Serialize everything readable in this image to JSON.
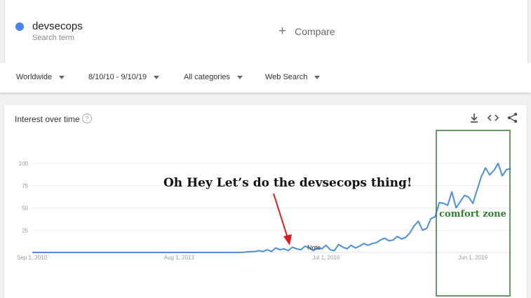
{
  "search": {
    "term": "devsecops",
    "term_sub": "Search term",
    "term_color": "#4285f4",
    "compare_label": "Compare"
  },
  "filters": [
    {
      "label": "Worldwide"
    },
    {
      "label": "8/10/10 - 9/10/19"
    },
    {
      "label": "All categories"
    },
    {
      "label": "Web Search"
    }
  ],
  "card": {
    "title": "Interest over time",
    "icons": [
      "download-icon",
      "embed-icon",
      "share-icon"
    ]
  },
  "annotations": {
    "callout": "Oh Hey Let’s do the devsecops thing!",
    "zone_label": "comfort zone",
    "note_label": "Note",
    "callout_color": "#e31a1c",
    "zone_color": "#2e7d32"
  },
  "chart_data": {
    "type": "line",
    "title": "",
    "xlabel": "",
    "ylabel": "",
    "ylim": [
      0,
      100
    ],
    "y_ticks": [
      "100",
      "75",
      "50",
      "25"
    ],
    "x_ticks": [
      {
        "label": "Sep 1, 2010",
        "month": 0
      },
      {
        "label": "Aug 1, 2013",
        "month": 35
      },
      {
        "label": "Jul 1, 2016",
        "month": 70
      },
      {
        "label": "Jun 1, 2019",
        "month": 105
      }
    ],
    "series": [
      {
        "color": "#4a90e2",
        "points": [
          [
            0,
            0
          ],
          [
            50,
            0
          ],
          [
            52,
            1
          ],
          [
            53,
            1
          ],
          [
            54,
            2
          ],
          [
            55,
            1
          ],
          [
            56,
            3
          ],
          [
            57,
            1
          ],
          [
            58,
            5
          ],
          [
            59,
            3
          ],
          [
            60,
            4
          ],
          [
            61,
            2
          ],
          [
            62,
            6
          ],
          [
            63,
            4
          ],
          [
            64,
            3
          ],
          [
            65,
            7
          ],
          [
            66,
            5
          ],
          [
            67,
            2
          ],
          [
            68,
            5
          ],
          [
            69,
            4
          ],
          [
            70,
            8
          ],
          [
            71,
            3
          ],
          [
            72,
            2
          ],
          [
            73,
            9
          ],
          [
            74,
            6
          ],
          [
            75,
            4
          ],
          [
            76,
            8
          ],
          [
            77,
            5
          ],
          [
            78,
            7
          ],
          [
            79,
            10
          ],
          [
            80,
            8
          ],
          [
            81,
            10
          ],
          [
            82,
            11
          ],
          [
            83,
            14
          ],
          [
            84,
            16
          ],
          [
            85,
            13
          ],
          [
            86,
            14
          ],
          [
            87,
            18
          ],
          [
            88,
            15
          ],
          [
            89,
            17
          ],
          [
            90,
            22
          ],
          [
            91,
            30
          ],
          [
            92,
            35
          ],
          [
            93,
            25
          ],
          [
            94,
            27
          ],
          [
            95,
            38
          ],
          [
            96,
            40
          ],
          [
            97,
            56
          ],
          [
            98,
            55
          ],
          [
            99,
            53
          ],
          [
            100,
            68
          ],
          [
            101,
            50
          ],
          [
            102,
            57
          ],
          [
            103,
            64
          ],
          [
            104,
            62
          ],
          [
            105,
            55
          ],
          [
            106,
            70
          ],
          [
            107,
            85
          ],
          [
            108,
            95
          ],
          [
            109,
            87
          ],
          [
            110,
            92
          ],
          [
            111,
            100
          ],
          [
            112,
            86
          ],
          [
            113,
            93
          ],
          [
            114,
            94
          ]
        ]
      }
    ]
  }
}
